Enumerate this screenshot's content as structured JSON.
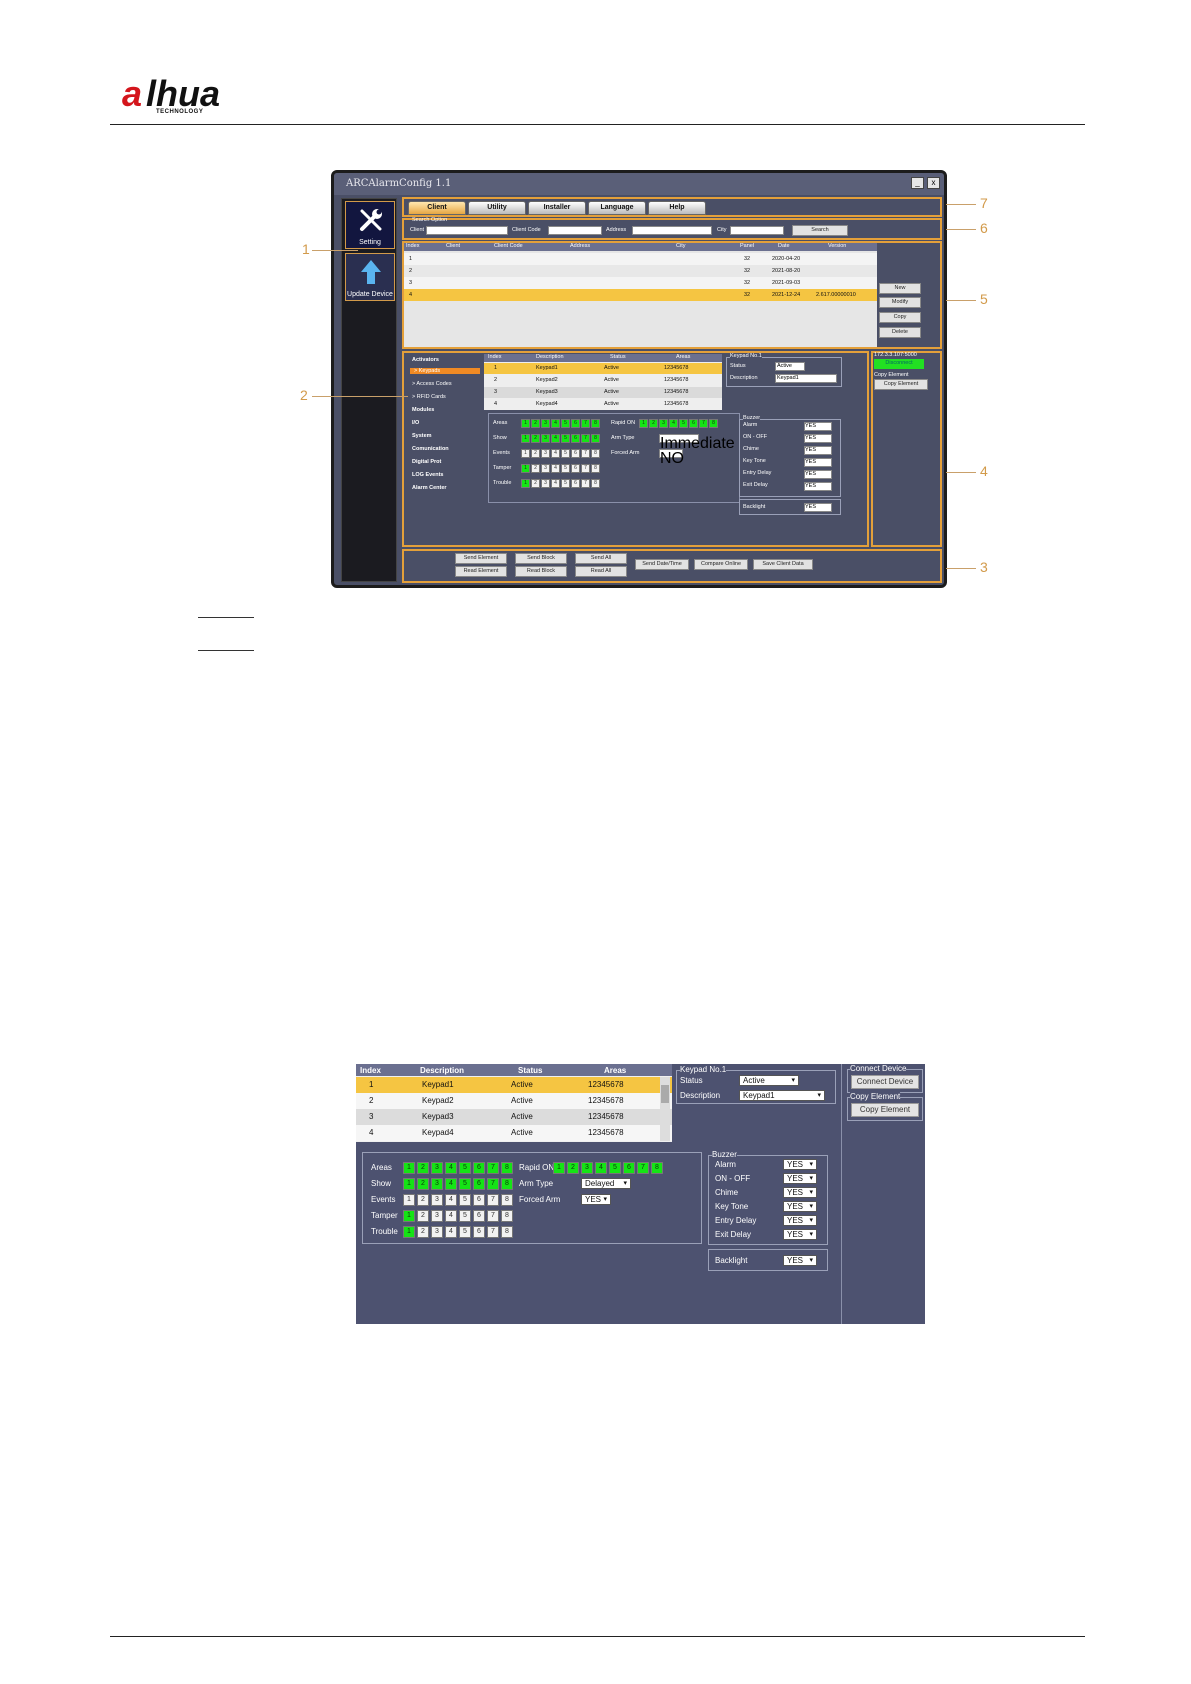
{
  "logo": {
    "brand": "alhua",
    "tagline": "TECHNOLOGY"
  },
  "app": {
    "title": "ARCAlarmConfig 1.1",
    "minimize": "_",
    "close": "x",
    "left_tiles": [
      {
        "label": "Setting",
        "icon": "wrench-screwdriver-icon"
      },
      {
        "label": "Update Device",
        "icon": "upload-arrow-icon"
      }
    ],
    "tabs": [
      "Client",
      "Utility",
      "Installer",
      "Language",
      "Help"
    ],
    "search": {
      "group": "Search Option",
      "client": "Client",
      "client_code": "Client Code",
      "address": "Address",
      "city": "City",
      "button": "Search"
    },
    "client_table": {
      "columns": [
        "Index",
        "Client",
        "Client Code",
        "Address",
        "City",
        "Panel",
        "Date",
        "Version"
      ],
      "rows": [
        [
          "1",
          "",
          "",
          "",
          "",
          "32",
          "2020-04-20",
          ""
        ],
        [
          "2",
          "",
          "",
          "",
          "",
          "32",
          "2021-08-20",
          ""
        ],
        [
          "3",
          "",
          "",
          "",
          "",
          "32",
          "2021-09-03",
          ""
        ],
        [
          "4",
          "",
          "",
          "",
          "",
          "32",
          "2021-12-24",
          "2.617.00000010"
        ]
      ]
    },
    "client_buttons": [
      "New",
      "Modify",
      "Copy",
      "Delete"
    ],
    "nav": [
      {
        "label": "Activators",
        "bold": true
      },
      {
        "label": "> Keypads",
        "bold": false,
        "active": true
      },
      {
        "label": "> Access Codes",
        "bold": false
      },
      {
        "label": "> RFID Cards",
        "bold": false
      },
      {
        "label": "Modules",
        "bold": true
      },
      {
        "label": "I/O",
        "bold": true
      },
      {
        "label": "System",
        "bold": true
      },
      {
        "label": "Comunication",
        "bold": true
      },
      {
        "label": "Digital Prot",
        "bold": true
      },
      {
        "label": "LOG Events",
        "bold": true
      },
      {
        "label": "Alarm Center",
        "bold": true
      }
    ],
    "keypad_table": {
      "columns": [
        "Index",
        "Description",
        "Status",
        "Areas"
      ],
      "rows": [
        [
          "1",
          "Keypad1",
          "Active",
          "12345678"
        ],
        [
          "2",
          "Keypad2",
          "Active",
          "12345678"
        ],
        [
          "3",
          "Keypad3",
          "Active",
          "12345678"
        ],
        [
          "4",
          "Keypad4",
          "Active",
          "12345678"
        ]
      ]
    },
    "keypad_no": {
      "group": "Keypad No.1",
      "status_label": "Status",
      "status": "Active",
      "desc_label": "Description",
      "desc": "Keypad1"
    },
    "connect": {
      "ip": "172.3.3.107:5000",
      "state": "Disconnect",
      "copy_group": "Copy Element",
      "copy_btn": "Copy Element"
    },
    "rows_labels": [
      "Areas",
      "Show",
      "Events",
      "Tamper",
      "Trouble"
    ],
    "right_labels": {
      "rapid": "Rapid ON",
      "arm": "Arm Type",
      "arm_value": "Immediate",
      "forced": "Forced Arm",
      "forced_value": "NO"
    },
    "buzzer": {
      "group": "Buzzer",
      "items": [
        "Alarm",
        "ON - OFF",
        "Chime",
        "Key Tone",
        "Entry Delay",
        "Exit Delay"
      ],
      "value": "YES",
      "backlight": "Backlight"
    },
    "bottom_buttons": [
      "Send Element",
      "Read Element",
      "Send Block",
      "Read Block",
      "Send All",
      "Read All",
      "Send Date/Time",
      "Compare Online",
      "Save Client Data"
    ]
  },
  "callouts": [
    "1",
    "2",
    "3",
    "4",
    "5",
    "6",
    "7"
  ],
  "detail": {
    "columns": [
      "Index",
      "Description",
      "Status",
      "Areas"
    ],
    "rows": [
      [
        "1",
        "Keypad1",
        "Active",
        "12345678"
      ],
      [
        "2",
        "Keypad2",
        "Active",
        "12345678"
      ],
      [
        "3",
        "Keypad3",
        "Active",
        "12345678"
      ],
      [
        "4",
        "Keypad4",
        "Active",
        "12345678"
      ]
    ],
    "keypad_group": "Keypad No.1",
    "status_label": "Status",
    "status": "Active",
    "desc_label": "Description",
    "desc": "Keypad1",
    "connect_group": "Connect Device",
    "connect_btn": "Connect Device",
    "copy_group": "Copy Element",
    "copy_btn": "Copy Element",
    "row_labels": [
      "Areas",
      "Show",
      "Events",
      "Tamper",
      "Trouble"
    ],
    "rapid": "Rapid ON",
    "arm_label": "Arm Type",
    "arm_value": "Delayed",
    "forced_label": "Forced Arm",
    "forced_value": "YES",
    "buzzer_group": "Buzzer",
    "buzzer_items": [
      "Alarm",
      "ON - OFF",
      "Chime",
      "Key Tone",
      "Entry Delay",
      "Exit Delay"
    ],
    "buzzer_value": "YES",
    "backlight_label": "Backlight",
    "backlight_value": "YES",
    "grid": {
      "areas": [
        1,
        1,
        1,
        1,
        1,
        1,
        1,
        1
      ],
      "show": [
        1,
        1,
        1,
        1,
        1,
        1,
        1,
        1
      ],
      "events": [
        0,
        0,
        0,
        0,
        0,
        0,
        0,
        0
      ],
      "tamper": [
        1,
        0,
        0,
        0,
        0,
        0,
        0,
        0
      ],
      "trouble": [
        1,
        0,
        0,
        0,
        0,
        0,
        0,
        0
      ],
      "rapid": [
        1,
        1,
        1,
        1,
        1,
        1,
        1,
        1
      ]
    }
  },
  "colors": {
    "accent": "#e4a03a",
    "highlight": "#f5c542",
    "panel": "#4d5270",
    "on": "#15e415"
  }
}
